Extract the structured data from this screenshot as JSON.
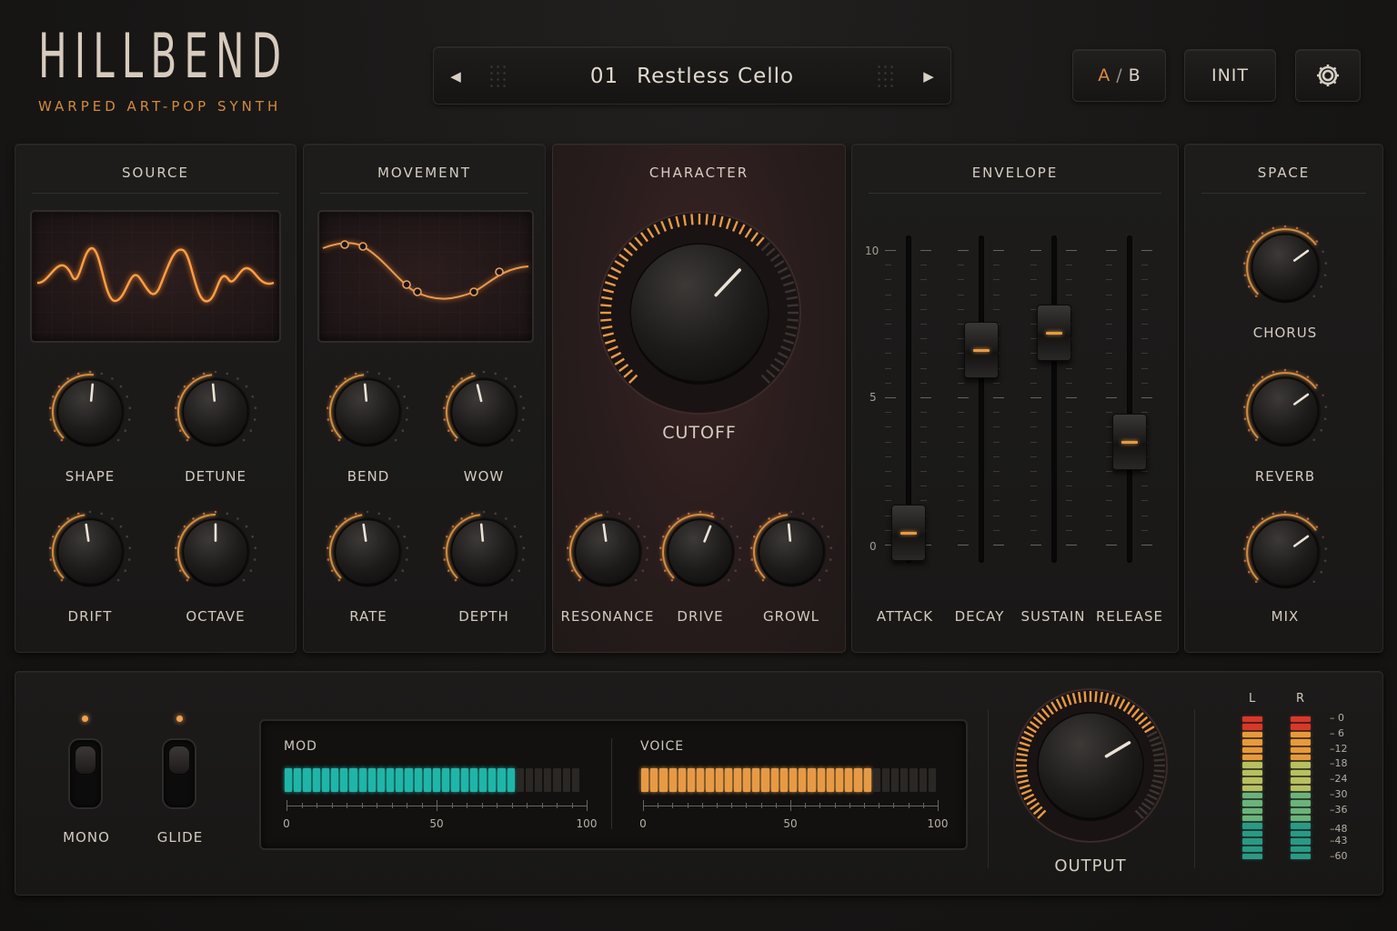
{
  "brand": {
    "title": "HILLBEND",
    "subtitle": "WARPED ART-POP SYNTH"
  },
  "header": {
    "preset_number": "01",
    "preset_name": "Restless Cello",
    "ab_a": "A",
    "ab_sep": "/",
    "ab_b": "B",
    "init_label": "INIT",
    "prev_icon": "chevron-left-icon",
    "next_icon": "chevron-right-icon",
    "settings_icon": "gear-icon"
  },
  "colors": {
    "accent": "#e69a45",
    "teal": "#1fb5a8",
    "panel": "#1b1a19",
    "character_bg": "#2a1c1c"
  },
  "source": {
    "title": "SOURCE",
    "knobs": [
      {
        "label": "SHAPE",
        "value": 0.52
      },
      {
        "label": "DETUNE",
        "value": 0.48
      },
      {
        "label": "DRIFT",
        "value": 0.47
      },
      {
        "label": "OCTAVE",
        "value": 0.5
      }
    ]
  },
  "movement": {
    "title": "MOVEMENT",
    "knobs": [
      {
        "label": "BEND",
        "value": 0.48
      },
      {
        "label": "WOW",
        "value": 0.45
      },
      {
        "label": "RATE",
        "value": 0.47
      },
      {
        "label": "DEPTH",
        "value": 0.48
      }
    ]
  },
  "character": {
    "title": "CHARACTER",
    "cutoff": {
      "label": "CUTOFF",
      "value": 0.66
    },
    "knobs": [
      {
        "label": "RESONANCE",
        "value": 0.47
      },
      {
        "label": "DRIVE",
        "value": 0.58
      },
      {
        "label": "GROWL",
        "value": 0.48
      }
    ]
  },
  "envelope": {
    "title": "ENVELOPE",
    "scale": [
      "10",
      "5",
      "0"
    ],
    "faders": [
      {
        "label": "ATTACK",
        "value": 0.04
      },
      {
        "label": "DECAY",
        "value": 0.66
      },
      {
        "label": "SUSTAIN",
        "value": 0.72
      },
      {
        "label": "RELEASE",
        "value": 0.35
      }
    ]
  },
  "space": {
    "title": "SPACE",
    "knobs": [
      {
        "label": "CHORUS",
        "value": 0.7
      },
      {
        "label": "REVERB",
        "value": 0.7
      },
      {
        "label": "MIX",
        "value": 0.7
      }
    ]
  },
  "bottom": {
    "mono_label": "MONO",
    "glide_label": "GLIDE",
    "mod": {
      "title": "MOD",
      "value": 0.77,
      "scale": [
        "0",
        "50",
        "100"
      ]
    },
    "voice": {
      "title": "VOICE",
      "value": 0.77,
      "scale": [
        "0",
        "50",
        "100"
      ]
    },
    "output": {
      "label": "OUTPUT",
      "value": 0.72
    },
    "vu": {
      "left_label": "L",
      "right_label": "R",
      "db_scale": [
        "– 0",
        "– 6",
        "–12",
        "–18",
        "–24",
        "–30",
        "–36",
        "–48",
        "–43",
        "–60"
      ]
    }
  }
}
